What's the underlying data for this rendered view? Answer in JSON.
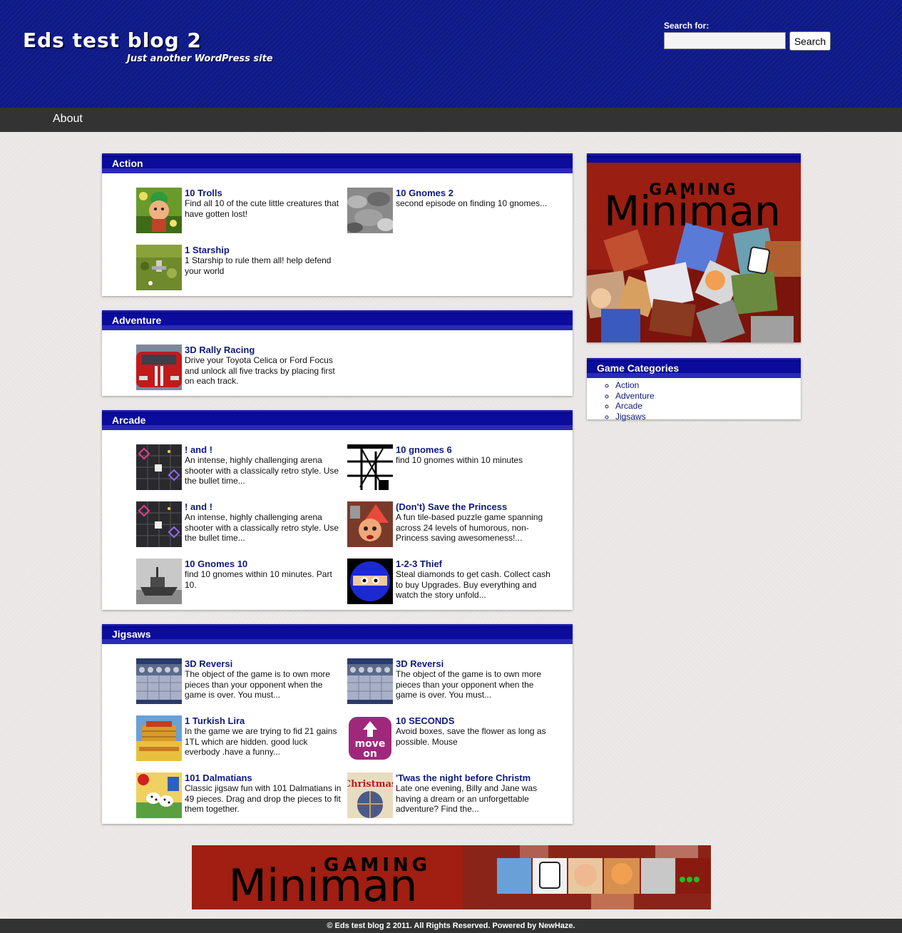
{
  "header": {
    "site_title": "Eds test blog 2",
    "tagline": "Just another WordPress site",
    "search_label": "Search for:",
    "search_value": "",
    "search_button": "Search"
  },
  "nav": {
    "items": [
      {
        "label": "About"
      }
    ]
  },
  "sections": [
    {
      "title": "Action",
      "games": [
        {
          "title": "10 Trolls",
          "desc": "Find all 10 of the cute little creatures that have gotten lost!",
          "icon": "troll-thumbnail"
        },
        {
          "title": "10 Gnomes 2",
          "desc": "second episode on finding 10 gnomes...",
          "icon": "rocky-landscape-thumbnail"
        },
        {
          "title": "1 Starship",
          "desc": "1 Starship to rule them all! help defend your world",
          "icon": "starship-thumbnail"
        }
      ]
    },
    {
      "title": "Adventure",
      "games": [
        {
          "title": "3D Rally Racing",
          "desc": "Drive your Toyota Celica or Ford Focus and unlock all five tracks by placing first on each track.",
          "icon": "red-car-thumbnail"
        }
      ]
    },
    {
      "title": "Arcade",
      "games": [
        {
          "title": "! and !",
          "desc": "An intense, highly challenging arena shooter with a classically retro style. Use the bullet time...",
          "icon": "arena-shooter-thumbnail"
        },
        {
          "title": "10 gnomes 6",
          "desc": "find 10 gnomes within 10 minutes",
          "icon": "bw-tower-thumbnail"
        },
        {
          "title": "! and !",
          "desc": "An intense, highly challenging arena shooter with a classically retro style. Use the bullet time...",
          "icon": "arena-shooter-thumbnail"
        },
        {
          "title": "(Don't) Save the Princess",
          "desc": "A fun tile-based puzzle game spanning across 24 levels of humorous, non-Princess saving awesomeness!...",
          "icon": "princess-thumbnail"
        },
        {
          "title": "10 Gnomes 10",
          "desc": "find 10 gnomes within 10 minutes. Part 10.",
          "icon": "boat-thumbnail"
        },
        {
          "title": "1-2-3 Thief",
          "desc": "Steal diamonds to get cash. Collect cash to buy Upgrades. Buy everything and watch the story unfold...",
          "icon": "ninja-thumbnail"
        }
      ]
    },
    {
      "title": "Jigsaws",
      "games": [
        {
          "title": "3D Reversi",
          "desc": "The object of the game is to own more pieces than your opponent when the game is over. You must...",
          "icon": "reversi-thumbnail"
        },
        {
          "title": "3D Reversi",
          "desc": "The object of the game is to own more pieces than your opponent when the game is over. You must...",
          "icon": "reversi-thumbnail"
        },
        {
          "title": "1 Turkish Lira",
          "desc": "In the game we are trying to fid 21 gains 1TL which are hidden. good luck everbody .have a funny...",
          "icon": "lira-thumbnail"
        },
        {
          "title": "10 SECONDS",
          "desc": "Avoid boxes, save the flower as long as possible. Mouse",
          "icon": "move-on-thumbnail",
          "icon_text": [
            "move",
            "on"
          ]
        },
        {
          "title": "101 Dalmatians",
          "desc": "Classic jigsaw fun with 101 Dalmatians in 49 pieces. Drag and drop the pieces to fit them together.",
          "icon": "dalmatians-thumbnail"
        },
        {
          "title": "'Twas the night before Christm",
          "desc": "Late one evening, Billy and Jane was having a dream or an unforgettable adventure? Find the...",
          "icon": "christmas-thumbnail",
          "icon_text": "Christmas"
        }
      ]
    }
  ],
  "sidebar": {
    "ad_brand": "Miniman",
    "ad_sub": "GAMING",
    "categories_title": "Game Categories",
    "categories": [
      "Action",
      "Adventure",
      "Arcade",
      "Jigsaws"
    ]
  },
  "bottom_banner": {
    "brand": "Miniman",
    "sub": "GAMING"
  },
  "footer": {
    "text": "© Eds test blog 2 2011. All Rights Reserved. Powered by NewHaze."
  },
  "colors": {
    "header_bg": "#121e93",
    "nav_bg": "#333333",
    "link": "#0f1a7d",
    "banner_red": "#8e1c10",
    "miniman_yellow": "#f6c21c"
  }
}
